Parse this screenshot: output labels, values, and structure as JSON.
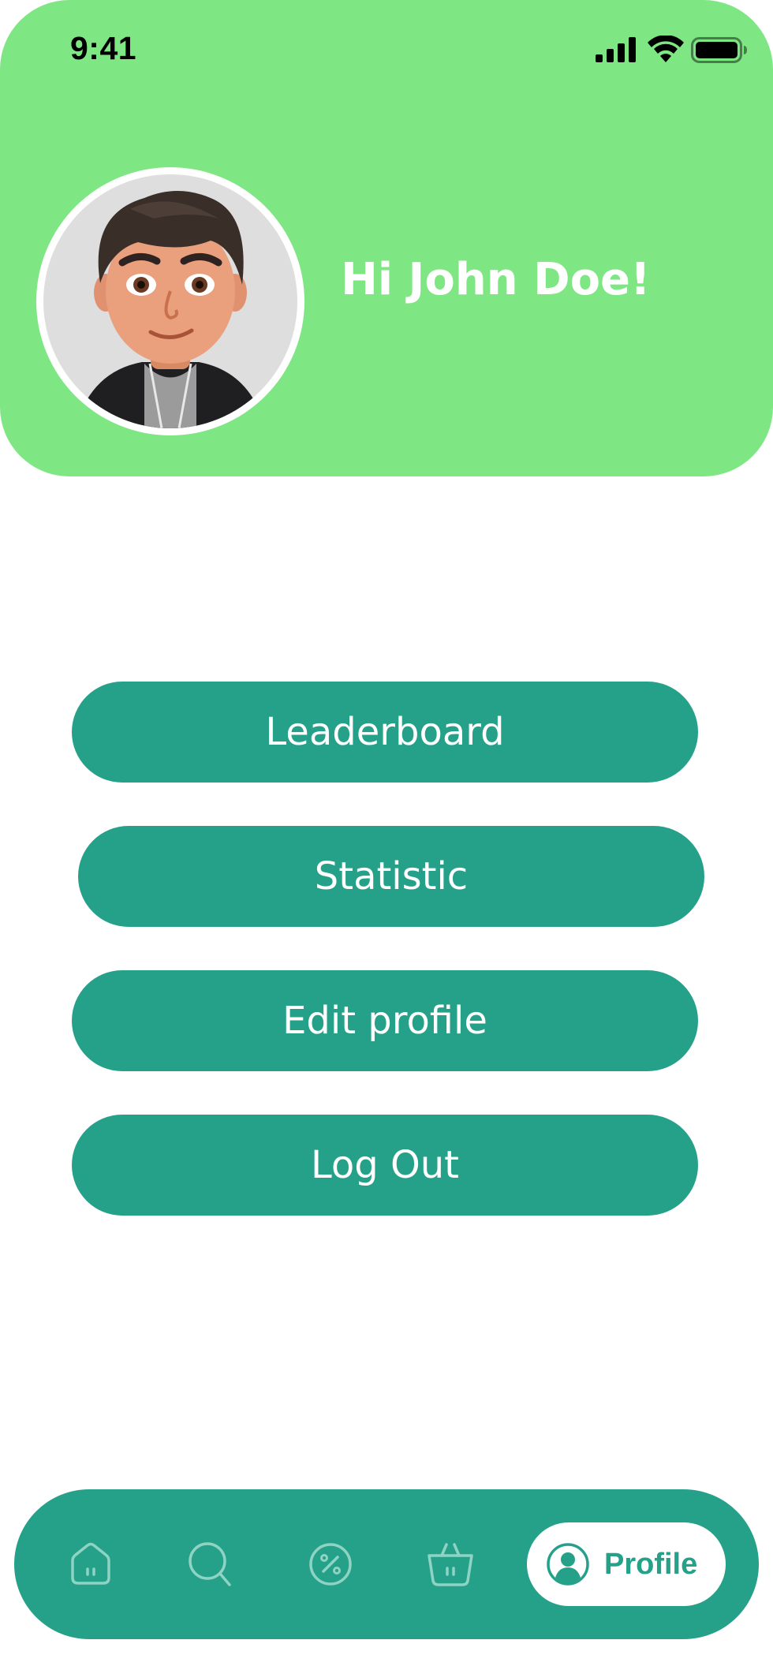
{
  "colors": {
    "header_bg": "#7ee683",
    "accent": "#25a18a",
    "text_on_accent": "#ffffff"
  },
  "status_bar": {
    "time": "9:41",
    "icons": [
      "cellular-signal-icon",
      "wifi-icon",
      "battery-icon"
    ]
  },
  "profile": {
    "greeting": "Hi John Doe!",
    "avatar_icon": "avatar-illustration"
  },
  "menu": {
    "buttons": [
      {
        "label": "Leaderboard"
      },
      {
        "label": "Statistic"
      },
      {
        "label": "Edit profile"
      },
      {
        "label": "Log Out"
      }
    ]
  },
  "bottom_nav": {
    "items": [
      {
        "icon": "home-icon"
      },
      {
        "icon": "search-icon"
      },
      {
        "icon": "discount-icon"
      },
      {
        "icon": "basket-icon"
      },
      {
        "icon": "profile-icon",
        "label": "Profile",
        "active": true
      }
    ]
  }
}
